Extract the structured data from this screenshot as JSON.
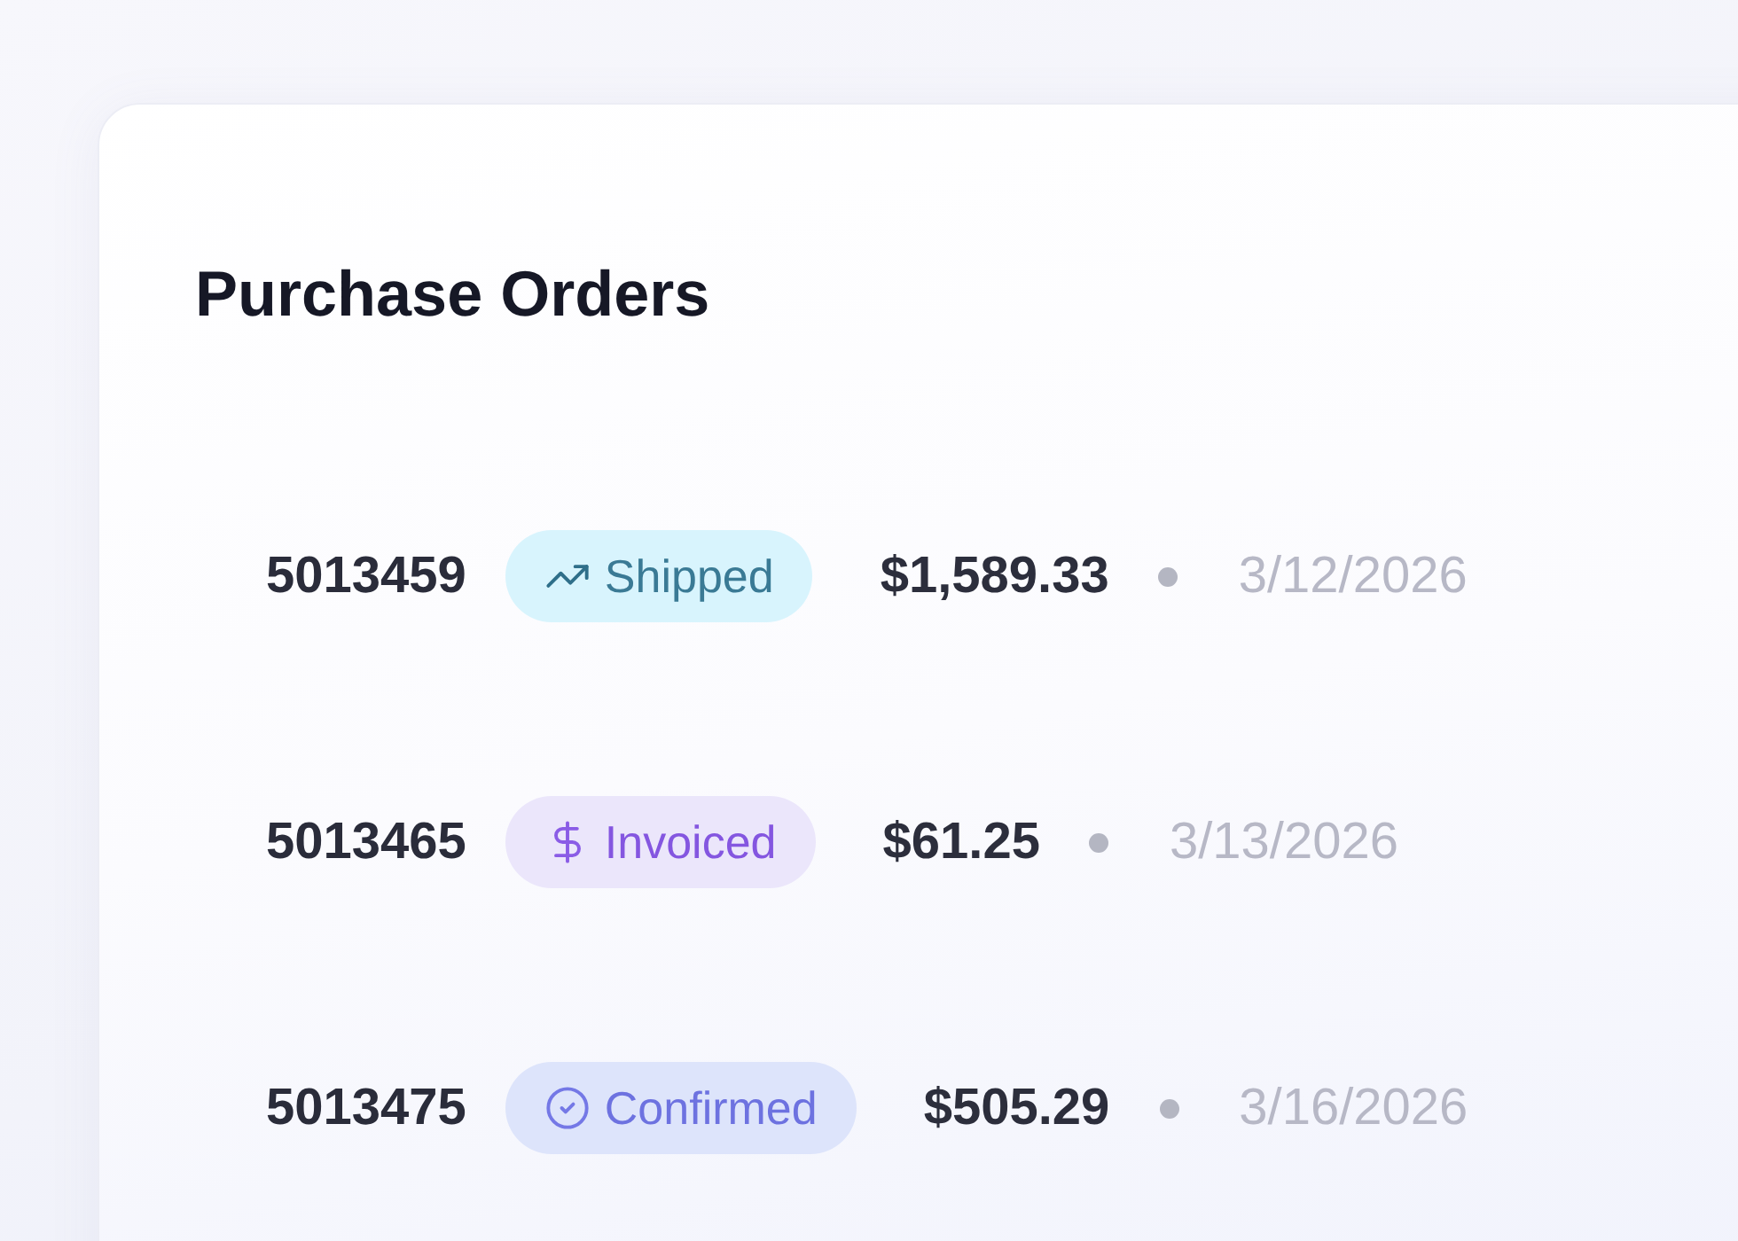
{
  "title": "Purchase Orders",
  "orders": [
    {
      "number": "5013459",
      "status": {
        "kind": "shipped",
        "label": "Shipped"
      },
      "amount": "$1,589.33",
      "date": "3/12/2026"
    },
    {
      "number": "5013465",
      "status": {
        "kind": "invoiced",
        "label": "Invoiced"
      },
      "amount": "$61.25",
      "date": "3/13/2026"
    },
    {
      "number": "5013475",
      "status": {
        "kind": "confirmed",
        "label": "Confirmed"
      },
      "amount": "$505.29",
      "date": "3/16/2026"
    }
  ]
}
